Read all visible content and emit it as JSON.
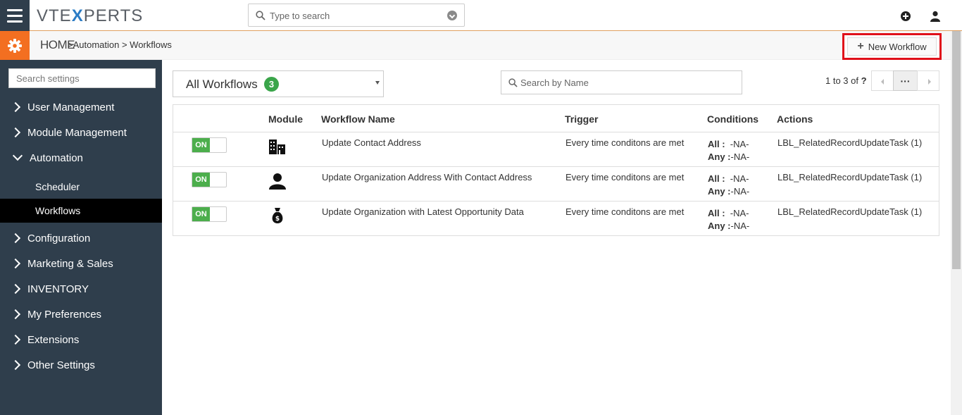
{
  "app": {
    "logo": {
      "prefix": "VTE",
      "x": "X",
      "suffix": "PERTS"
    },
    "global_search_placeholder": "Type to search"
  },
  "breadcrumb": {
    "home": "HOME",
    "rest": ">Automation >  Workflows"
  },
  "toolbar": {
    "new_workflow_label": "New Workflow"
  },
  "sidebar": {
    "search_placeholder": "Search settings",
    "items": [
      {
        "label": "User Management"
      },
      {
        "label": "Module Management"
      },
      {
        "label": "Automation"
      },
      {
        "label": "Configuration"
      },
      {
        "label": "Marketing & Sales"
      },
      {
        "label": "INVENTORY"
      },
      {
        "label": "My Preferences"
      },
      {
        "label": "Extensions"
      },
      {
        "label": "Other Settings"
      }
    ],
    "sub_items": [
      {
        "label": "Scheduler"
      },
      {
        "label": "Workflows"
      }
    ]
  },
  "filter": {
    "label": "All Workflows",
    "count": "3"
  },
  "name_search_placeholder": "Search by Name",
  "pager": {
    "text": "1 to 3  of",
    "total": "?",
    "more": "···"
  },
  "table": {
    "headers": [
      "Module",
      "Workflow Name",
      "Trigger",
      "Conditions",
      "Actions"
    ],
    "rows": [
      {
        "status": "ON",
        "module_icon": "building-icon",
        "name": "Update Contact Address",
        "trigger": "Every time conditons are met",
        "all_label": "All :",
        "all_value": "-NA-",
        "any_label": "Any :",
        "any_value": "-NA-",
        "actions": "LBL_RelatedRecordUpdateTask (1)"
      },
      {
        "status": "ON",
        "module_icon": "person-icon",
        "name": "Update Organization Address With Contact Address",
        "trigger": "Every time conditons are met",
        "all_label": "All :",
        "all_value": "-NA-",
        "any_label": "Any :",
        "any_value": "-NA-",
        "actions": "LBL_RelatedRecordUpdateTask (1)"
      },
      {
        "status": "ON",
        "module_icon": "money-bag-icon",
        "name": "Update Organization with Latest Opportunity Data",
        "trigger": "Every time conditons are met",
        "all_label": "All :",
        "all_value": "-NA-",
        "any_label": "Any :",
        "any_value": "-NA-",
        "actions": "LBL_RelatedRecordUpdateTask (1)"
      }
    ]
  },
  "colors": {
    "sidebar_bg": "#2f3e4c",
    "accent_orange": "#f36f21",
    "toggle_on": "#4cae4c",
    "badge_green": "#3aa54a",
    "highlight_red": "#e0101a"
  }
}
